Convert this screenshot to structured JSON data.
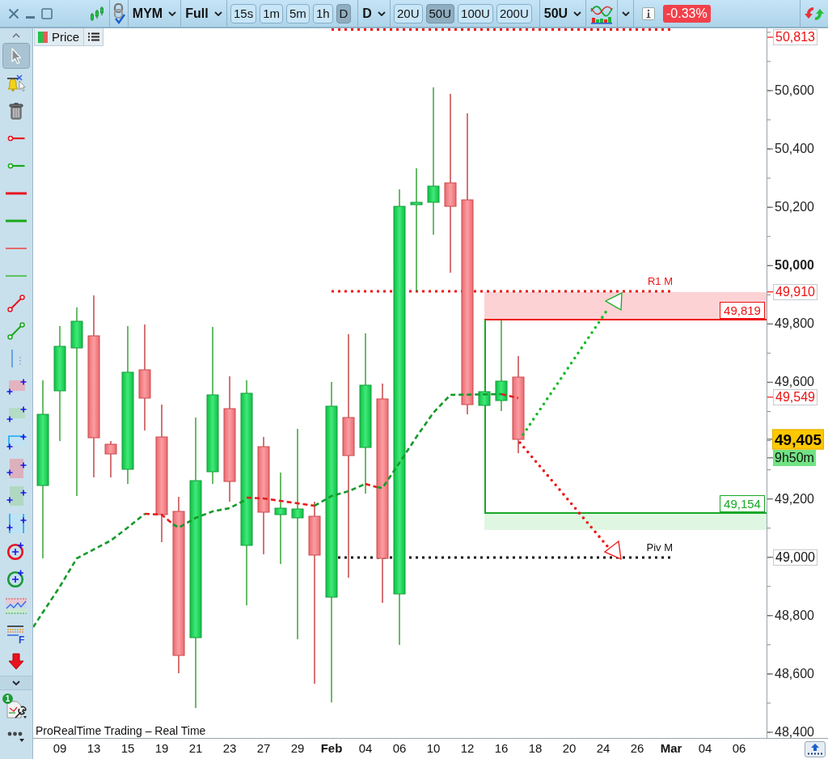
{
  "toolbar": {
    "symbol": "MYM",
    "range": "Full",
    "intervals": [
      {
        "label": "15s",
        "selected": false
      },
      {
        "label": "1m",
        "selected": false
      },
      {
        "label": "5m",
        "selected": false
      },
      {
        "label": "1h",
        "selected": false
      },
      {
        "label": "D",
        "selected": true
      }
    ],
    "timeframe": "D",
    "units": [
      {
        "label": "20U",
        "selected": false
      },
      {
        "label": "50U",
        "selected": true
      },
      {
        "label": "100U",
        "selected": false
      },
      {
        "label": "200U",
        "selected": false
      }
    ],
    "unit_menu": "50U",
    "change": "-0.33%"
  },
  "tools": {
    "items": [
      {
        "kind": "pointer",
        "selected": true
      },
      {
        "kind": "alert",
        "selected": false
      },
      {
        "kind": "trash",
        "selected": false
      },
      {
        "kind": "ray",
        "color": "#e8141e",
        "selected": false
      },
      {
        "kind": "ray",
        "color": "#1aa81a",
        "selected": false
      },
      {
        "kind": "hline_thick",
        "color": "#e8141e",
        "selected": false
      },
      {
        "kind": "hline_thick",
        "color": "#1aa81a",
        "selected": false
      },
      {
        "kind": "hline_thin",
        "color": "#e46a6a",
        "selected": false
      },
      {
        "kind": "hline_thin",
        "color": "#5cc25c",
        "selected": false
      },
      {
        "kind": "segment",
        "color": "#e8141e",
        "selected": false
      },
      {
        "kind": "segment",
        "color": "#1aa81a",
        "selected": false
      },
      {
        "kind": "vline",
        "selected": false
      },
      {
        "kind": "zone_wide",
        "color": "#e3b4c0",
        "selected": false
      },
      {
        "kind": "zone_wide",
        "color": "#b5dcc4",
        "selected": false
      },
      {
        "kind": "frame_wide",
        "selected": false
      },
      {
        "kind": "zone_tall",
        "color": "#dcb0bc",
        "selected": false
      },
      {
        "kind": "zone_tall",
        "color": "#b0d8c0",
        "selected": false
      },
      {
        "kind": "frame_tall",
        "selected": false
      },
      {
        "kind": "circle",
        "color": "#e8141e",
        "selected": false
      },
      {
        "kind": "circle",
        "color": "#1a9a3a",
        "selected": false
      },
      {
        "kind": "band",
        "selected": false
      },
      {
        "kind": "fibonacci",
        "label": "F",
        "selected": false
      },
      {
        "kind": "arrow_down",
        "selected": false
      }
    ],
    "settings_badge": "1"
  },
  "chart": {
    "legend": "Price",
    "source": "ProRealTime Trading – Real Time",
    "levels": [
      {
        "kind": "resistance",
        "label": "R1 M"
      },
      {
        "kind": "pivot",
        "label": "Piv M"
      }
    ],
    "zones": [
      {
        "kind": "upper",
        "label": "49,819"
      },
      {
        "kind": "lower",
        "label": "49,154"
      }
    ],
    "price_axis": [
      {
        "text": "50,813",
        "kind": "level_red"
      },
      {
        "text": "50,600",
        "kind": "tick"
      },
      {
        "text": "50,400",
        "kind": "tick"
      },
      {
        "text": "50,200",
        "kind": "tick"
      },
      {
        "text": "50,000",
        "kind": "major"
      },
      {
        "text": "49,910",
        "kind": "level_red"
      },
      {
        "text": "49,800",
        "kind": "tick"
      },
      {
        "text": "49,600",
        "kind": "tick"
      },
      {
        "text": "49,549",
        "kind": "level_red"
      },
      {
        "text": "49,405",
        "kind": "last"
      },
      {
        "text": "9h50m",
        "kind": "countdown"
      },
      {
        "text": "49,200",
        "kind": "tick"
      },
      {
        "text": "49,000",
        "kind": "level_black"
      },
      {
        "text": "48,800",
        "kind": "tick"
      },
      {
        "text": "48,600",
        "kind": "tick"
      },
      {
        "text": "48,400",
        "kind": "tick"
      }
    ],
    "time_axis": [
      {
        "label": "09",
        "kind": "day"
      },
      {
        "label": "13",
        "kind": "day"
      },
      {
        "label": "15",
        "kind": "day"
      },
      {
        "label": "19",
        "kind": "day"
      },
      {
        "label": "21",
        "kind": "day"
      },
      {
        "label": "23",
        "kind": "day"
      },
      {
        "label": "27",
        "kind": "day"
      },
      {
        "label": "29",
        "kind": "day"
      },
      {
        "label": "Feb",
        "kind": "month"
      },
      {
        "label": "04",
        "kind": "day"
      },
      {
        "label": "06",
        "kind": "day"
      },
      {
        "label": "10",
        "kind": "day"
      },
      {
        "label": "12",
        "kind": "day"
      },
      {
        "label": "16",
        "kind": "day"
      },
      {
        "label": "18",
        "kind": "day"
      },
      {
        "label": "20",
        "kind": "day"
      },
      {
        "label": "24",
        "kind": "day"
      },
      {
        "label": "26",
        "kind": "day"
      },
      {
        "label": "Mar",
        "kind": "month"
      },
      {
        "label": "04",
        "kind": "day"
      },
      {
        "label": "06",
        "kind": "day"
      }
    ]
  }
}
